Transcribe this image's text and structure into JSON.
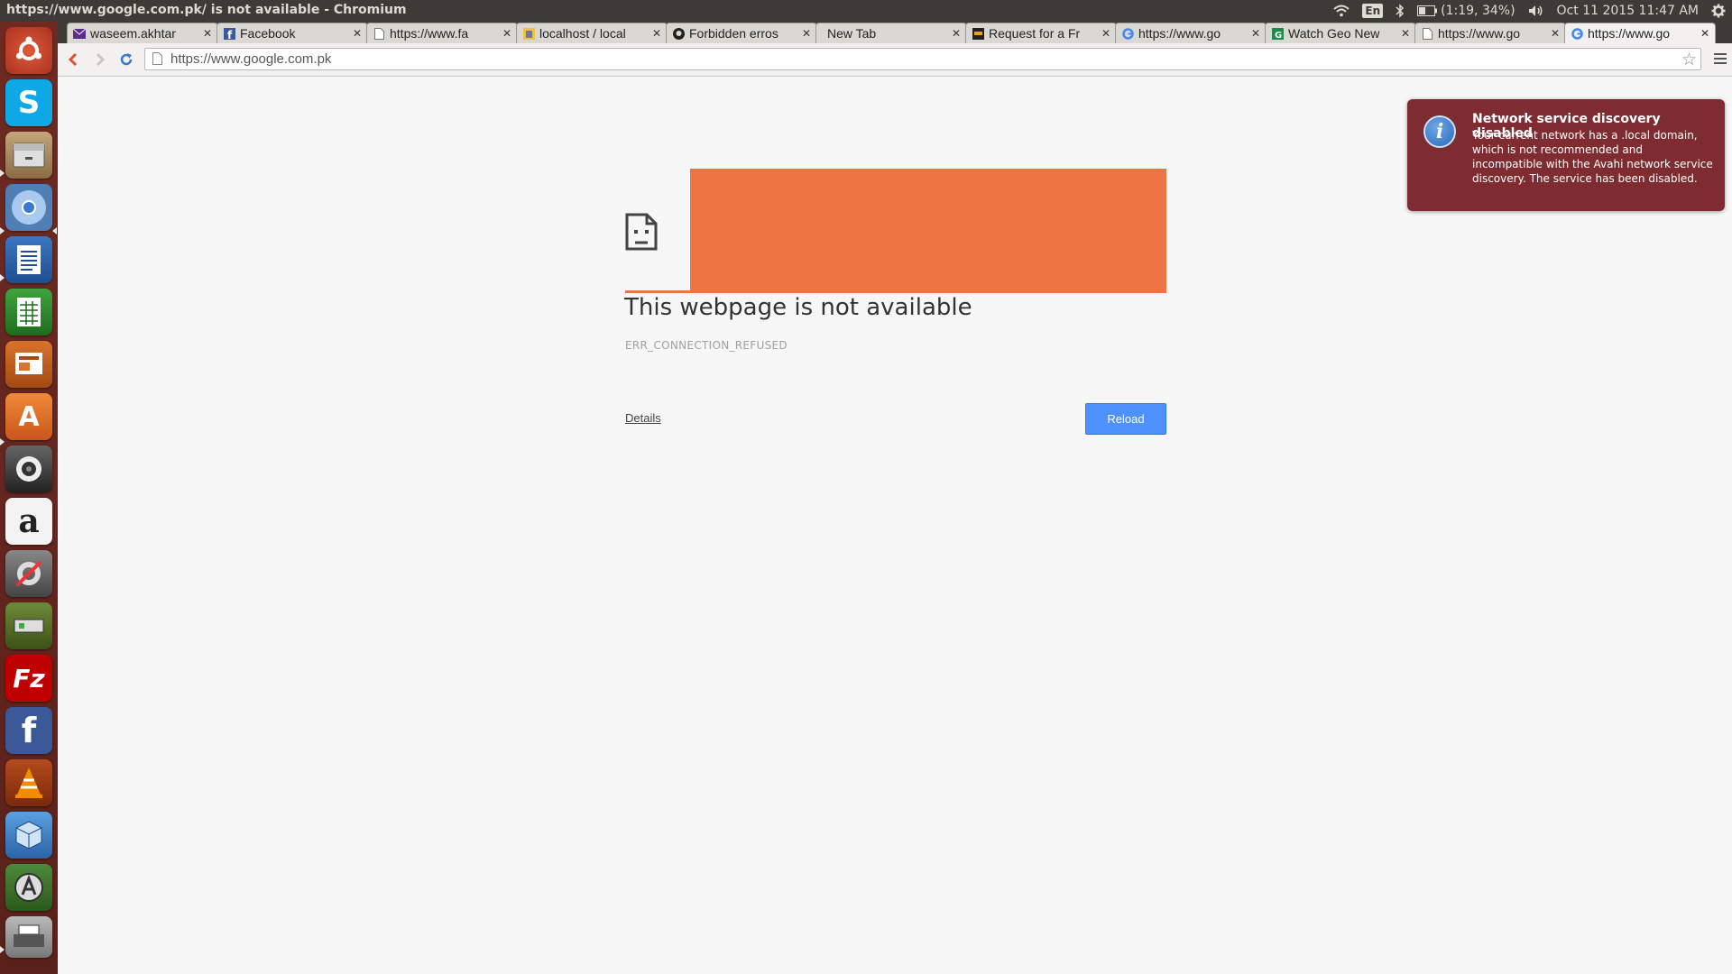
{
  "panel": {
    "window_title": "https://www.google.com.pk/ is not available - Chromium",
    "keyboard": "En",
    "battery": "(1:19, 34%)",
    "clock": "Oct 11 2015 11:47 AM"
  },
  "launcher": {
    "items": [
      {
        "name": "dash"
      },
      {
        "name": "skype"
      },
      {
        "name": "files"
      },
      {
        "name": "chromium"
      },
      {
        "name": "libreoffice-writer"
      },
      {
        "name": "libreoffice-calc"
      },
      {
        "name": "libreoffice-impress"
      },
      {
        "name": "ubuntu-software-center"
      },
      {
        "name": "webcam"
      },
      {
        "name": "amazon",
        "glyph": "a"
      },
      {
        "name": "system-settings"
      },
      {
        "name": "network-tool"
      },
      {
        "name": "filezilla",
        "glyph": "Fz"
      },
      {
        "name": "facebook",
        "glyph": "f"
      },
      {
        "name": "vlc"
      },
      {
        "name": "virtualbox"
      },
      {
        "name": "software-updater"
      },
      {
        "name": "printer"
      }
    ]
  },
  "browser": {
    "tabs": [
      {
        "label": "waseem.akhtar",
        "icon": "mail-icon"
      },
      {
        "label": "Facebook",
        "icon": "facebook-icon"
      },
      {
        "label": "https://www.fa",
        "icon": "page-icon"
      },
      {
        "label": "localhost / local",
        "icon": "phpmyadmin-icon"
      },
      {
        "label": "Forbidden erros",
        "icon": "github-icon"
      },
      {
        "label": "New Tab",
        "icon": ""
      },
      {
        "label": "Request for a Fr",
        "icon": "site-icon"
      },
      {
        "label": "https://www.go",
        "icon": "google-icon"
      },
      {
        "label": "Watch Geo New",
        "icon": "geo-icon"
      },
      {
        "label": "https://www.go",
        "icon": "page-icon"
      },
      {
        "label": "https://www.go",
        "icon": "google-icon",
        "active": true
      }
    ],
    "url": "https://www.google.com.pk"
  },
  "error_page": {
    "title": "This webpage is not available",
    "code": "ERR_CONNECTION_REFUSED",
    "details_label": "Details",
    "reload_label": "Reload",
    "redaction_color": "#ee7443"
  },
  "notification": {
    "title": "Network service discovery disabled",
    "body": "Your current network has a .local domain, which is not recommended and incompatible with the Avahi network service discovery. The service has been disabled.",
    "bg_color": "#7e2b31"
  }
}
